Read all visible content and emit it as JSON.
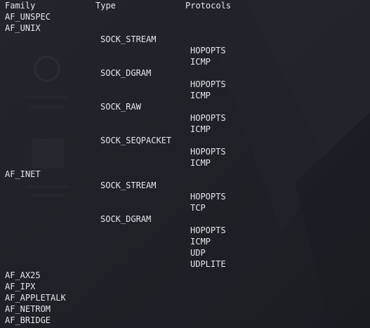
{
  "header": {
    "family": "Family",
    "type": "Type",
    "protocols": "Protocols"
  },
  "rows": [
    {
      "col": "family",
      "text": "AF_UNSPEC"
    },
    {
      "col": "family",
      "text": "AF_UNIX"
    },
    {
      "col": "type",
      "text": "SOCK_STREAM"
    },
    {
      "col": "proto",
      "text": "HOPOPTS"
    },
    {
      "col": "proto",
      "text": "ICMP"
    },
    {
      "col": "type",
      "text": "SOCK_DGRAM"
    },
    {
      "col": "proto",
      "text": "HOPOPTS"
    },
    {
      "col": "proto",
      "text": "ICMP"
    },
    {
      "col": "type",
      "text": "SOCK_RAW"
    },
    {
      "col": "proto",
      "text": "HOPOPTS"
    },
    {
      "col": "proto",
      "text": "ICMP"
    },
    {
      "col": "type",
      "text": "SOCK_SEQPACKET"
    },
    {
      "col": "proto",
      "text": "HOPOPTS"
    },
    {
      "col": "proto",
      "text": "ICMP"
    },
    {
      "col": "family",
      "text": "AF_INET"
    },
    {
      "col": "type",
      "text": "SOCK_STREAM"
    },
    {
      "col": "proto",
      "text": "HOPOPTS"
    },
    {
      "col": "proto",
      "text": "TCP"
    },
    {
      "col": "type",
      "text": "SOCK_DGRAM"
    },
    {
      "col": "proto",
      "text": "HOPOPTS"
    },
    {
      "col": "proto",
      "text": "ICMP"
    },
    {
      "col": "proto",
      "text": "UDP"
    },
    {
      "col": "proto",
      "text": "UDPLITE"
    },
    {
      "col": "family",
      "text": "AF_AX25"
    },
    {
      "col": "family",
      "text": "AF_IPX"
    },
    {
      "col": "family",
      "text": "AF_APPLETALK"
    },
    {
      "col": "family",
      "text": "AF_NETROM"
    },
    {
      "col": "family",
      "text": "AF_BRIDGE"
    }
  ],
  "colors": {
    "background": "#1d2126",
    "text": "#e4e7eb"
  }
}
